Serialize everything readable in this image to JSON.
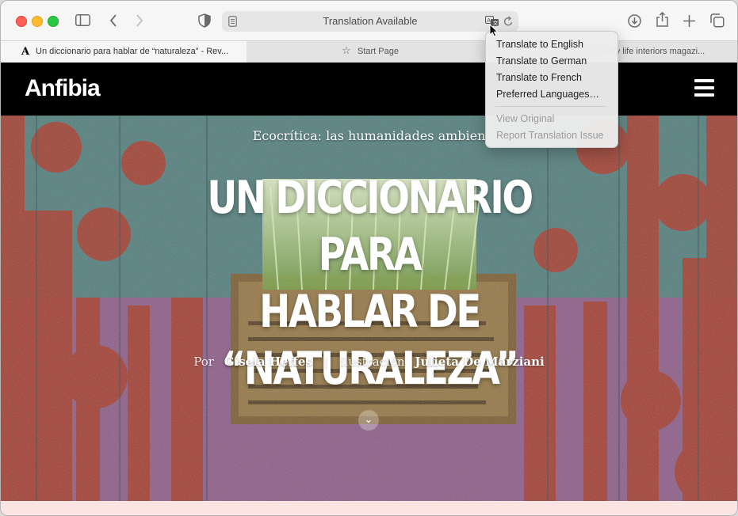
{
  "browser": {
    "address_title": "Translation Available",
    "tabs": [
      {
        "label": "Un diccionario para hablar de “naturaleza” - Rev...",
        "favicon": "A"
      },
      {
        "label": "Start Page"
      },
      {
        "label": "yday life interiors magazi..."
      }
    ]
  },
  "translate_menu": {
    "items": [
      "Translate to English",
      "Translate to German",
      "Translate to French",
      "Preferred Languages…"
    ],
    "disabled_items": [
      "View Original",
      "Report Translation Issue"
    ]
  },
  "site": {
    "logo": "Anfibia",
    "kicker": "Ecocrítica: las humanidades ambien",
    "headline_lines": [
      "UN DICCIONARIO PARA",
      "HABLAR DE",
      "“NATURALEZA”"
    ],
    "byline": {
      "por": "Por",
      "author": "Gisela Heffes",
      "sep": "|",
      "ilustracion": "Ilustración",
      "illustrator": "Julieta De Marziani"
    }
  },
  "colors": {
    "hero_teal": "#4d7a78",
    "hero_red": "#a8382a",
    "hero_purple": "#8a5a86",
    "pink_footer": "#fbe4e1"
  }
}
